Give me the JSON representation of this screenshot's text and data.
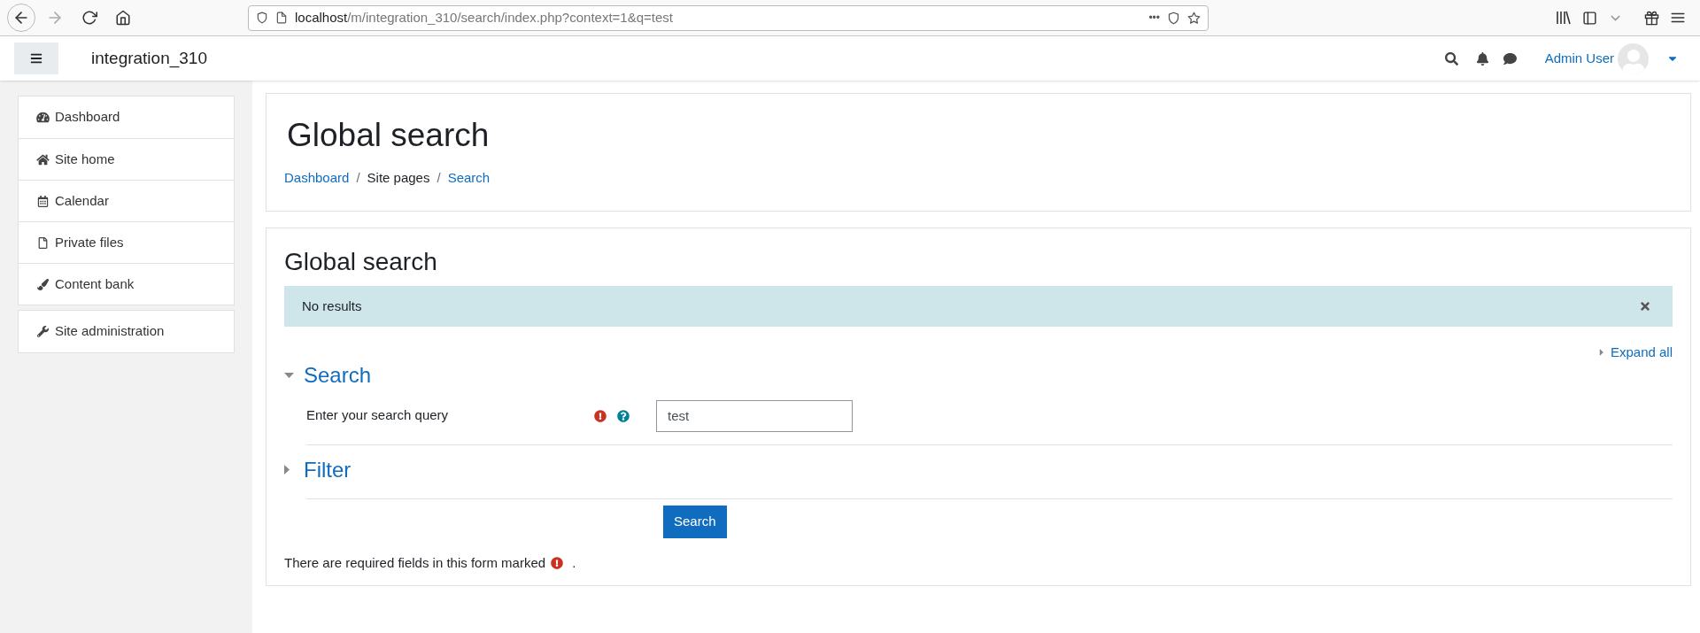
{
  "browser": {
    "url_host": "localhost",
    "url_path": "/m/integration_310/search/index.php?context=1&q=test",
    "menu_dots": "•••"
  },
  "navbar": {
    "site_name": "integration_310",
    "user_name": "Admin User"
  },
  "sidebar": {
    "groups": [
      [
        {
          "label": "Dashboard",
          "kind": "dashboard"
        },
        {
          "label": "Site home",
          "kind": "home"
        },
        {
          "label": "Calendar",
          "kind": "calendar"
        },
        {
          "label": "Private files",
          "kind": "file"
        },
        {
          "label": "Content bank",
          "kind": "brush"
        }
      ],
      [
        {
          "label": "Site administration",
          "kind": "wrench"
        }
      ]
    ]
  },
  "page_header": {
    "title": "Global search",
    "breadcrumb": [
      {
        "label": "Dashboard",
        "link": true
      },
      {
        "separator": "/",
        "label": "Site pages",
        "link": false
      },
      {
        "separator": "/",
        "label": "Search",
        "link": true
      }
    ]
  },
  "main": {
    "title": "Global search",
    "alert": "No results",
    "expand_all": "Expand all",
    "sections": [
      {
        "title": "Search",
        "expanded": true,
        "fields": [
          {
            "label": "Enter your search query",
            "value": "test",
            "required": true
          }
        ]
      },
      {
        "title": "Filter",
        "expanded": false
      }
    ],
    "submit": "Search",
    "required_note": "There are required fields in this form marked",
    "required_note_end": "."
  }
}
